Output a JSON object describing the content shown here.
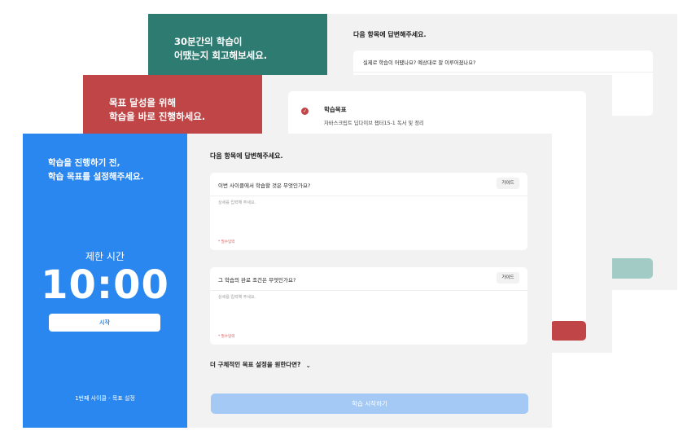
{
  "colors": {
    "teal": "#2e7b72",
    "red": "#bf4546",
    "blue": "#2a87f0",
    "teal_button_faded": "#a3cbc6",
    "blue_button_faded": "#a4c9f5",
    "required_red": "#d9534f"
  },
  "back_card": {
    "sidebar_title_line1": "30분간의 학습이",
    "sidebar_title_line2": "어땠는지 회고해보세요.",
    "main_question": "다음 항목에 답변해주세요.",
    "box_question": "실제로 학습이 어땠나요? 예상대로 잘 이루어졌나요?"
  },
  "middle_card": {
    "sidebar_title_line1": "목표 달성을 위해",
    "sidebar_title_line2": "학습을 바로 진행하세요.",
    "goal_label": "학습목표",
    "goal_value": "자바스크립트 딥다이브 챕터15-1 독서 및 정리",
    "check_icon": "check-circle-icon"
  },
  "front_card": {
    "sidebar_title_line1": "학습을 진행하기 전,",
    "sidebar_title_line2": "학습 목표를 설정해주세요.",
    "time_limit_label": "제한 시간",
    "timer": "10:00",
    "start_button": "시작",
    "cycle_info": "1번째 사이클 - 목표 설정",
    "main_question": "다음 항목에 답변해주세요.",
    "questions": [
      {
        "text": "이번 사이클에서 학습할 것은 무엇인가요?",
        "guide_button": "가이드",
        "placeholder": "상세를 입력해 주세요.",
        "required": "* 필수입력"
      },
      {
        "text": "그 학습의 완료 조건은 무엇인가요?",
        "guide_button": "가이드",
        "placeholder": "상세를 입력해 주세요.",
        "required": "* 필수입력"
      }
    ],
    "detail_toggle": "더 구체적인 목표 설정을 원한다면?",
    "chevron_icon": "chevron-down-icon",
    "submit_button": "학습 시작하기"
  }
}
